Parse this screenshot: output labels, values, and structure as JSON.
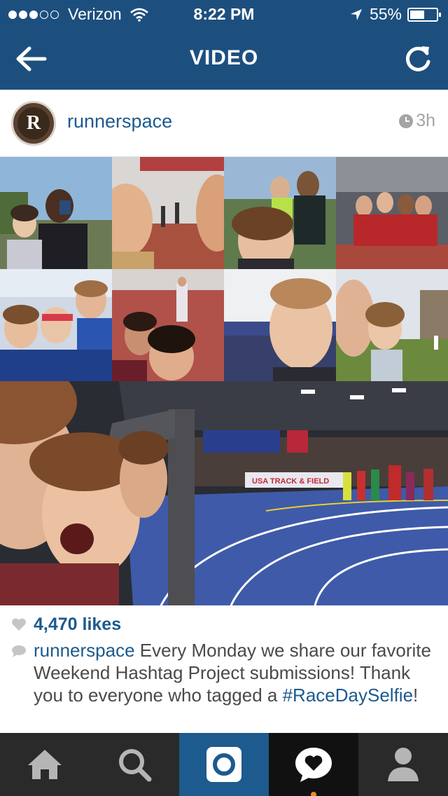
{
  "status_bar": {
    "carrier": "Verizon",
    "time": "8:22 PM",
    "battery": "55%",
    "battery_level": 0.55,
    "signal_bars": 3
  },
  "nav": {
    "title": "VIDEO",
    "back_icon": "arrow-left-icon",
    "refresh_icon": "refresh-icon"
  },
  "post": {
    "username": "runnerspace",
    "avatar_letter": "R",
    "time_ago": "3h",
    "likes": "4,470 likes",
    "caption_user": "runnerspace",
    "caption_text": " Every Monday we share our favorite Weekend Hashtag Project submissions! Thank you to everyone who tagged a ",
    "caption_tag": "#RaceDaySelfie",
    "caption_end": "!"
  },
  "media": {
    "banner_text": "USA TRACK & FIELD"
  },
  "tabbar": {
    "tabs": [
      {
        "icon": "home-icon"
      },
      {
        "icon": "search-icon"
      },
      {
        "icon": "camera-icon"
      },
      {
        "icon": "activity-heart-icon"
      },
      {
        "icon": "profile-icon"
      }
    ],
    "colors": {
      "active": "#1d5a8e",
      "background": "#2a2a2a",
      "notification": "#f08a24"
    }
  },
  "colors": {
    "header": "#1d4f7e",
    "link": "#1d5a8e"
  }
}
